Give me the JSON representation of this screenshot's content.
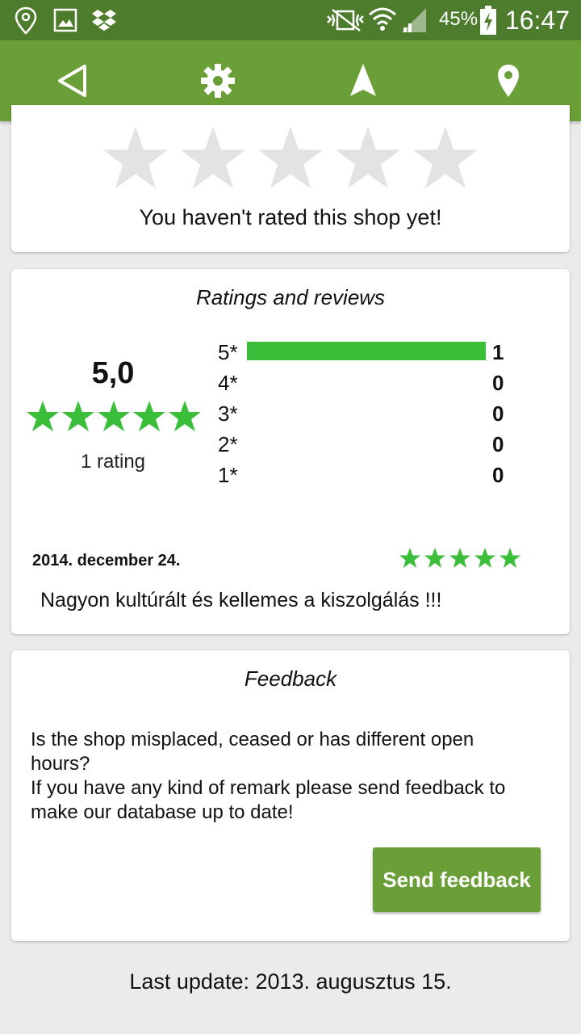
{
  "status_bar": {
    "icons": [
      "location-pin-icon",
      "gallery-icon",
      "dropbox-icon",
      "vibrate-icon",
      "wifi-icon",
      "signal-icon",
      "battery-charging-icon"
    ],
    "battery": "45%",
    "time": "16:47"
  },
  "toolbar": {
    "icons": [
      "back-triangle-icon",
      "settings-gear-icon",
      "navigation-arrow-icon",
      "map-pin-icon"
    ]
  },
  "my_rating": {
    "stars": 0,
    "max": 5,
    "prompt": "You haven't rated this shop yet!"
  },
  "ratings": {
    "title": "Ratings and reviews",
    "average": "5,0",
    "average_stars": 5,
    "count_label": "1 rating",
    "histogram": [
      {
        "label": "5*",
        "count": "1",
        "fraction": 1
      },
      {
        "label": "4*",
        "count": "0",
        "fraction": 0
      },
      {
        "label": "3*",
        "count": "0",
        "fraction": 0
      },
      {
        "label": "2*",
        "count": "0",
        "fraction": 0
      },
      {
        "label": "1*",
        "count": "0",
        "fraction": 0
      }
    ],
    "review": {
      "date": "2014. december 24.",
      "stars": 5,
      "text": "Nagyon kultúrált és kellemes a kiszolgálás !!!"
    }
  },
  "feedback": {
    "title": "Feedback",
    "line1": "Is the shop misplaced, ceased or has different open",
    "line2": "hours?",
    "line3": "If you have any kind of remark please send feedback to",
    "line4": "make our database up to date!",
    "button_label": "Send feedback"
  },
  "last_update": "Last update: 2013. augusztus 15.",
  "colors": {
    "status_bar": "#4d7d2c",
    "toolbar": "#6a9f37",
    "star_green": "#3bbf3b",
    "star_empty": "#e3e3e3"
  }
}
